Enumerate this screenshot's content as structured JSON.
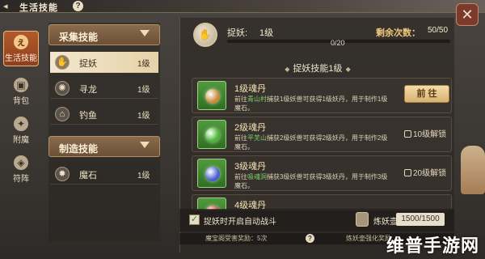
{
  "window": {
    "title": "生活技能"
  },
  "sidebar": {
    "items": [
      {
        "label": "生活技能",
        "icon": "life-skill-icon",
        "glyph": "ぇ",
        "active": true
      },
      {
        "label": "背包",
        "icon": "bag-icon",
        "glyph": "▣",
        "active": false
      },
      {
        "label": "附魔",
        "icon": "enchant-icon",
        "glyph": "✦",
        "active": false
      },
      {
        "label": "符阵",
        "icon": "array-icon",
        "glyph": "◈",
        "active": false
      }
    ]
  },
  "skill_list": {
    "categories": [
      {
        "title": "采集技能"
      },
      {
        "title": "制造技能"
      }
    ],
    "gather": [
      {
        "name": "捉妖",
        "level": "1级",
        "icon": "catch-demon-icon",
        "glyph": "✋",
        "active": true
      },
      {
        "name": "寻龙",
        "level": "1级",
        "icon": "dragon-search-icon",
        "glyph": "✺",
        "active": false
      },
      {
        "name": "钓鱼",
        "level": "1级",
        "icon": "fishing-icon",
        "glyph": "⌂",
        "active": false
      }
    ],
    "craft": [
      {
        "name": "魔石",
        "level": "1级",
        "icon": "magic-stone-icon",
        "glyph": "✹",
        "active": false
      }
    ]
  },
  "progress": {
    "label": "捉妖:",
    "level": "1级",
    "remain_label": "剩余次数：",
    "remain_value": "50/50",
    "count": "0/20",
    "fill_fraction": 0.0,
    "icon_glyph": "✋"
  },
  "section": {
    "title": "捉妖技能1级"
  },
  "items": [
    {
      "name": "1级魂丹",
      "desc_prefix": "前往",
      "desc_highlight": "青山村",
      "desc_suffix": "捕获1级妖兽可获得1级妖丹，用于制作1级魔石。",
      "orb_color": "#c98b3a",
      "action": {
        "type": "button",
        "label": "前 往"
      }
    },
    {
      "name": "2级魂丹",
      "desc_prefix": "前往",
      "desc_highlight": "平芜山",
      "desc_suffix": "捕获2级妖兽可获得2级妖丹，用于制作2级魔石。",
      "orb_color": "#4fb53a",
      "action": {
        "type": "lock",
        "label": "10级解锁"
      }
    },
    {
      "name": "3级魂丹",
      "desc_prefix": "前往",
      "desc_highlight": "吸魂洞",
      "desc_suffix": "捕获3级妖兽可获得3级妖丹，用于制作3级魔石。",
      "orb_color": "#4a5fd0",
      "action": {
        "type": "lock",
        "label": "20级解锁"
      }
    },
    {
      "name": "4级魂丹",
      "desc_prefix": "",
      "desc_highlight": "",
      "desc_suffix": "",
      "orb_color": "#d04a3a",
      "action": {
        "type": "lock",
        "label": ""
      }
    }
  ],
  "bottom": {
    "auto_battle_label": "捉妖时开启自动战斗",
    "auto_battle_checked": true,
    "pot_label": "炼妖壶",
    "pot_value": "1500/1500"
  },
  "footer": {
    "left_text": "魔宝阁受害奖励：5次",
    "right_text": "炼妖壶强化奖励"
  },
  "watermark": {
    "text": "维普手游网"
  },
  "colors": {
    "accent": "#b35a2c",
    "gold": "#d8b272",
    "highlight_green": "#7fd36a"
  }
}
